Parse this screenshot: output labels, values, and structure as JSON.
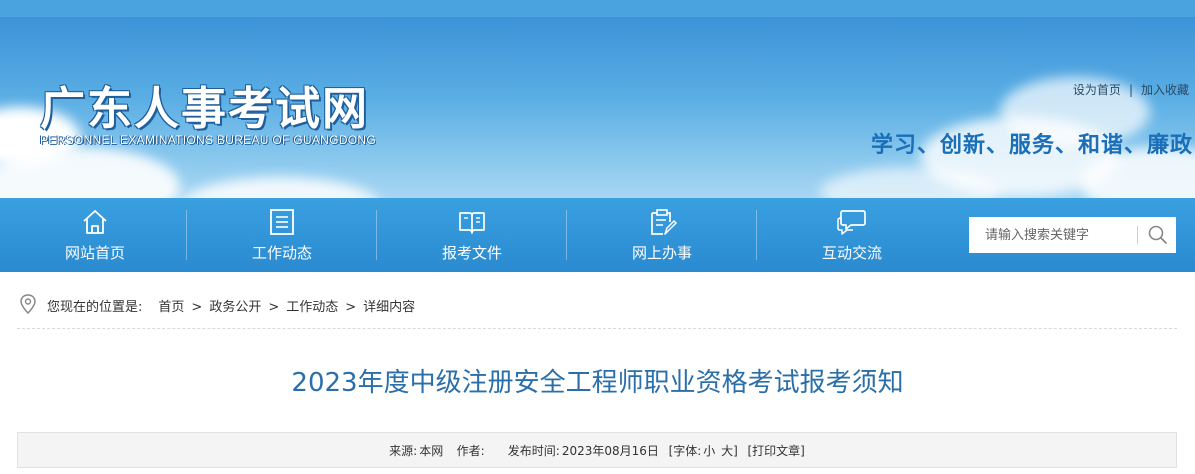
{
  "site": {
    "title_cn": "广东人事考试网",
    "title_en": "PERSONNEL EXAMINATIONS BUREAU OF GUANGDONG",
    "slogan": "学习、创新、服务、和谐、廉政"
  },
  "toplinks": {
    "set_home": "设为首页",
    "separator": "|",
    "favorite": "加入收藏"
  },
  "nav": [
    {
      "label": "网站首页",
      "icon": "home-icon"
    },
    {
      "label": "工作动态",
      "icon": "list-document-icon"
    },
    {
      "label": "报考文件",
      "icon": "open-book-icon"
    },
    {
      "label": "网上办事",
      "icon": "clipboard-pen-icon"
    },
    {
      "label": "互动交流",
      "icon": "chat-bubbles-icon"
    }
  ],
  "search": {
    "placeholder": "请输入搜索关键字",
    "icon": "search-icon"
  },
  "breadcrumb": {
    "prefix": "您现在的位置是:",
    "items": [
      "首页",
      "政务公开",
      "工作动态",
      "详细内容"
    ],
    "arrow": ">"
  },
  "article": {
    "title": "2023年度中级注册安全工程师职业资格考试报考须知",
    "source_label": "来源:",
    "source": "本网",
    "author_label": "作者:",
    "author": "",
    "date_label": "发布时间:",
    "date": "2023年08月16日",
    "font_label": "[字体:",
    "font_small": "小",
    "font_large": "大]",
    "print": "[打印文章]"
  },
  "colors": {
    "topbar": "#4aa3df",
    "nav": "#2a8ad0",
    "title": "#2a6faa",
    "slogan": "#1a6fb8"
  }
}
